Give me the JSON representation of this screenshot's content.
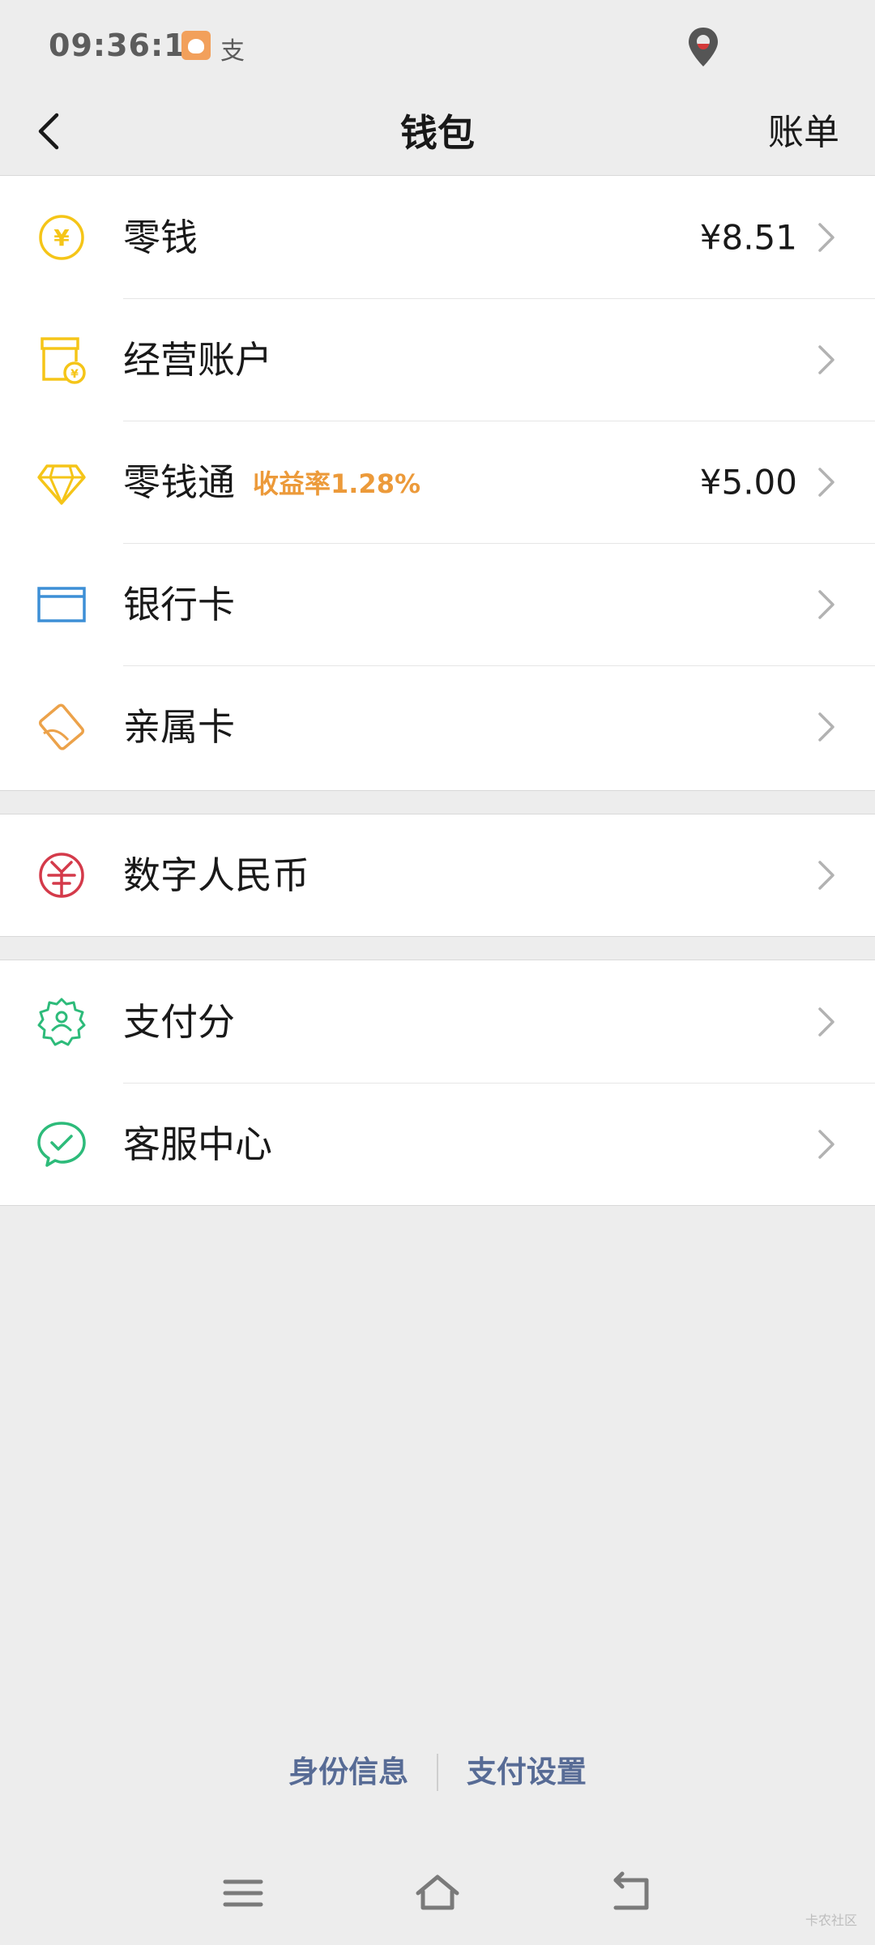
{
  "status_bar": {
    "time": "09:36:12",
    "alipay_glyph": "支"
  },
  "header": {
    "title": "钱包",
    "bill_label": "账单"
  },
  "groups": [
    {
      "items": [
        {
          "label": "零钱",
          "value": "¥8.51",
          "icon": "coin-yen-icon"
        },
        {
          "label": "经营账户",
          "value": "",
          "icon": "store-account-icon"
        },
        {
          "label": "零钱通",
          "tag": "收益率1.28%",
          "value": "¥5.00",
          "icon": "diamond-icon"
        },
        {
          "label": "银行卡",
          "value": "",
          "icon": "bank-card-icon"
        },
        {
          "label": "亲属卡",
          "value": "",
          "icon": "family-card-icon"
        }
      ]
    },
    {
      "items": [
        {
          "label": "数字人民币",
          "value": "",
          "icon": "digital-rmb-icon"
        }
      ]
    },
    {
      "items": [
        {
          "label": "支付分",
          "value": "",
          "icon": "pay-score-icon"
        },
        {
          "label": "客服中心",
          "value": "",
          "icon": "customer-service-icon"
        }
      ]
    }
  ],
  "footer": {
    "identity_label": "身份信息",
    "settings_label": "支付设置"
  },
  "watermark": "卡农社区",
  "colors": {
    "background": "#ededed",
    "link": "#576b95",
    "tag": "#ec9a3a",
    "coin": "#f5c518",
    "bank_card": "#3d8fd6",
    "family_card": "#eca24a",
    "digital_rmb": "#d43a4a",
    "green": "#2dbb7a"
  }
}
